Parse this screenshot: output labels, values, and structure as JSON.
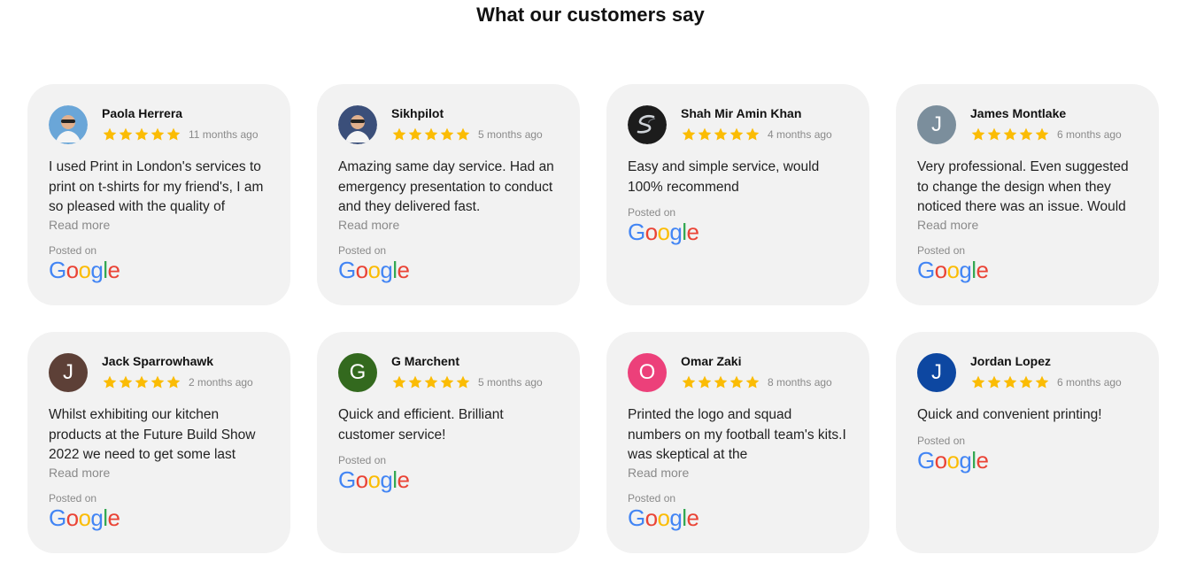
{
  "heading": "What our customers say",
  "posted_label": "Posted on",
  "google_word": "Google",
  "read_more_label": "Read more",
  "star_color": "#fbbc04",
  "reviews": [
    {
      "name": "Paola Herrera",
      "time": "11 months ago",
      "rating": 5,
      "text": "I used Print in London's services to print on t-shirts for my friend's, I am so pleased with the quality of",
      "read_more": true,
      "avatar": {
        "type": "photo",
        "icon": "person-photo-icon",
        "color": "#6aa6d8"
      }
    },
    {
      "name": "Sikhpilot",
      "time": "5 months ago",
      "rating": 5,
      "text": "Amazing same day service. Had an emergency presentation to conduct and they delivered fast.",
      "read_more": true,
      "avatar": {
        "type": "photo",
        "icon": "person-photo-icon",
        "color": "#3b4f7a"
      }
    },
    {
      "name": "Shah Mir Amin Khan",
      "time": "4 months ago",
      "rating": 5,
      "text": "Easy and simple service, would 100% recommend",
      "read_more": false,
      "avatar": {
        "type": "photo",
        "icon": "logo-photo-icon",
        "color": "#1c1c1c"
      }
    },
    {
      "name": "James Montlake",
      "time": "6 months ago",
      "rating": 5,
      "text": "Very professional. Even suggested to change the design when they noticed there was an issue. Would",
      "read_more": true,
      "avatar": {
        "type": "letter",
        "letter": "J",
        "color": "#7b8e9c"
      }
    },
    {
      "name": "Jack Sparrowhawk",
      "time": "2 months ago",
      "rating": 5,
      "text": "Whilst exhibiting our kitchen products at the Future Build Show 2022 we need to get some last",
      "read_more": true,
      "avatar": {
        "type": "letter",
        "letter": "J",
        "color": "#5d4037"
      }
    },
    {
      "name": "G Marchent",
      "time": "5 months ago",
      "rating": 5,
      "text": "Quick and efficient. Brilliant customer service!",
      "read_more": false,
      "avatar": {
        "type": "letter",
        "letter": "G",
        "color": "#33691e"
      }
    },
    {
      "name": "Omar Zaki",
      "time": "8 months ago",
      "rating": 5,
      "text": "Printed the logo and squad numbers on my football team's kits.I was skeptical at the",
      "read_more": true,
      "avatar": {
        "type": "letter",
        "letter": "O",
        "color": "#ec407a"
      }
    },
    {
      "name": "Jordan Lopez",
      "time": "6 months ago",
      "rating": 5,
      "text": "Quick and convenient printing!",
      "read_more": false,
      "avatar": {
        "type": "letter",
        "letter": "J",
        "color": "#0d47a1"
      }
    }
  ]
}
